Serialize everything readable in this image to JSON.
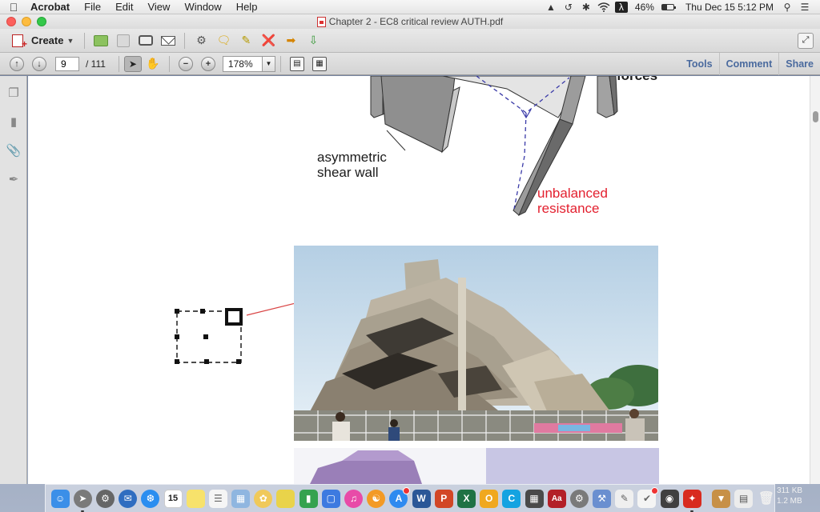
{
  "menubar": {
    "app_name": "Acrobat",
    "menus": [
      "File",
      "Edit",
      "View",
      "Window",
      "Help"
    ],
    "battery": "46%",
    "datetime": "Thu Dec 15  5:12 PM",
    "battery_level": 0.46
  },
  "window": {
    "title": "Chapter 2 - EC8 critical review AUTH.pdf"
  },
  "toolbar": {
    "create_label": "Create",
    "current_page": "9",
    "total_pages": "/ 111",
    "zoom": "178%",
    "links": [
      "Tools",
      "Comment",
      "Share"
    ]
  },
  "document": {
    "diagram_label_1": "asymmetric",
    "diagram_label_2": "shear wall",
    "red_label_1": "unbalanced",
    "red_label_2": "resistance",
    "partial_top_text": "forces"
  },
  "dock": {
    "calendar_day": "15",
    "stat_1": "311 KB",
    "stat_2": "1.2 MB",
    "colors": {
      "finder": "#3b8fe8",
      "launchpad": "#7a7a7a",
      "prefs": "#666666",
      "thunderbird": "#2f6dc0",
      "safari": "#2a8ef0",
      "calendar": "#ffffff",
      "notes": "#f7e26b",
      "reminders": "#f5f5f5",
      "preview": "#8fb6e0",
      "photos": "#f0c95a",
      "stickies": "#e9d34a",
      "numbers": "#35a24f",
      "keynote": "#3d7ae0",
      "itunes": "#e84ba8",
      "ibooks": "#f39a25",
      "appstore": "#2e8af0",
      "word": "#2b5797",
      "powerpoint": "#d24726",
      "excel": "#1f7244",
      "outlook": "#f0a81f",
      "onenote": "#14a3e1",
      "calculator": "#4a4a4a",
      "dictionary": "#b32028",
      "utility": "#7a7a7a",
      "xcode": "#6a8fd0",
      "textedit": "#efefef",
      "dashboard": "#f4f4f4",
      "photobooth": "#404040",
      "acrobat": "#d82b1f",
      "downloads": "#c79047"
    }
  }
}
